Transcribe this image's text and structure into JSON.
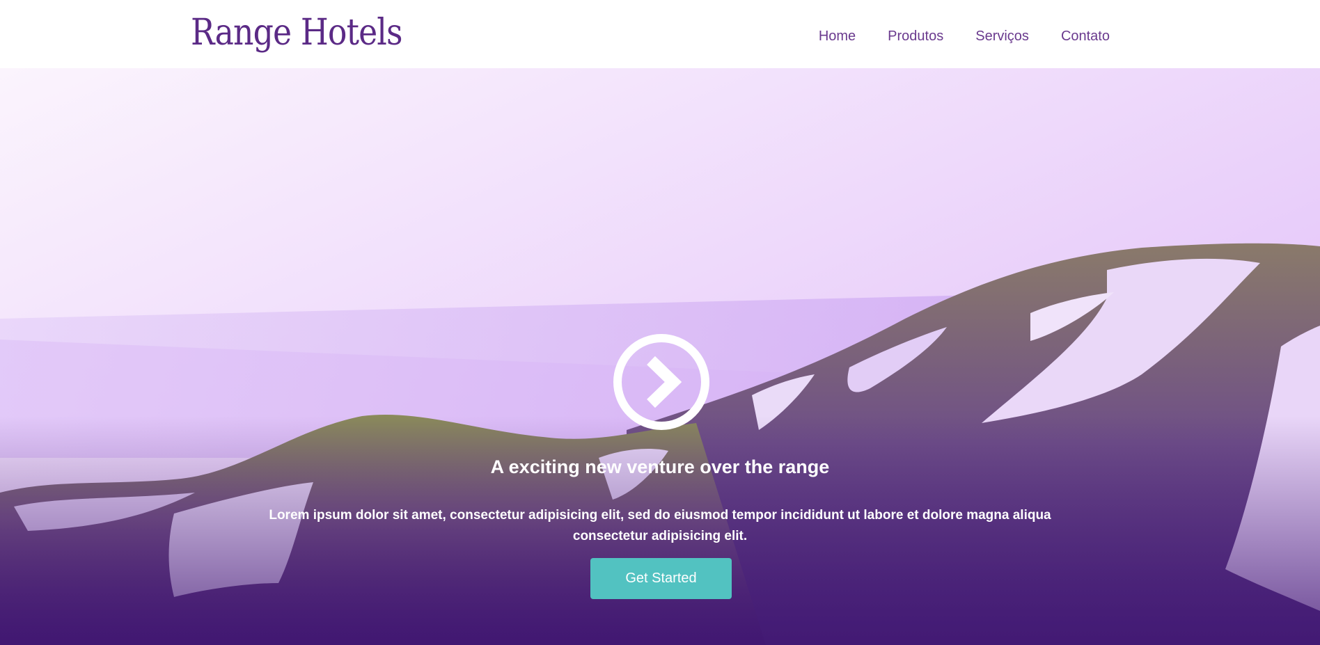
{
  "header": {
    "logo_text": "Range Hotels",
    "nav": [
      {
        "label": "Home"
      },
      {
        "label": "Produtos"
      },
      {
        "label": "Serviços"
      },
      {
        "label": "Contato"
      }
    ]
  },
  "hero": {
    "icon": "chevron-circle-right-icon",
    "headline": "A exciting new venture over the range",
    "subtext": "Lorem ipsum dolor sit amet, consectetur adipisicing elit, sed do eiusmod tempor incididunt ut labore et dolore magna aliqua consectetur adipisicing elit.",
    "cta_label": "Get Started"
  },
  "colors": {
    "brand": "#5b2a86",
    "nav_text": "#6a3a8e",
    "cta": "#52c2c1",
    "overlay_light": "#f3e6fb",
    "overlay_mid": "#c9a0f0",
    "overlay_dark": "#4a1c78"
  }
}
